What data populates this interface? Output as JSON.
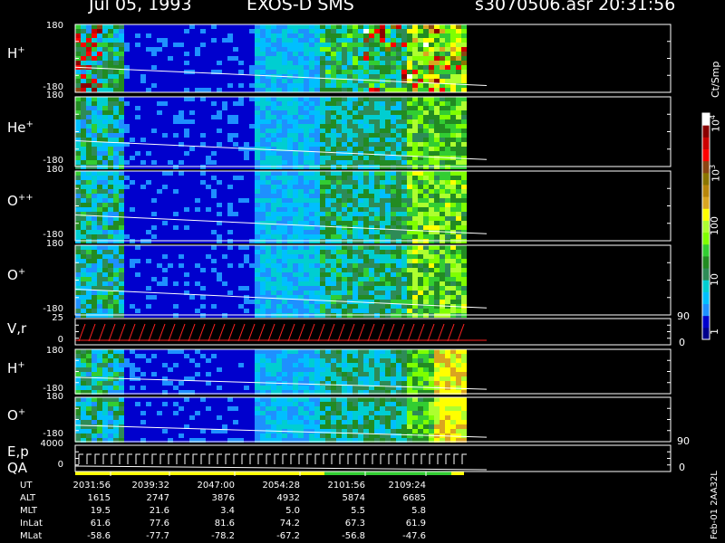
{
  "header": {
    "date": "Jul 05, 1993",
    "instrument": "EXOS-D SMS",
    "file": "s3070506.asr",
    "time": "20:31:56"
  },
  "panels": [
    {
      "id": "h_plus",
      "label_main": "H",
      "label_sup": "+",
      "ymax": "180",
      "ymin": "-180"
    },
    {
      "id": "he_plus",
      "label_main": "He",
      "label_sup": "+",
      "ymax": "180",
      "ymin": "-180"
    },
    {
      "id": "o_pp",
      "label_main": "O",
      "label_sup": "++",
      "ymax": "180",
      "ymin": "-180"
    },
    {
      "id": "o_plus",
      "label_main": "O",
      "label_sup": "+",
      "ymax": "180",
      "ymin": "-180"
    },
    {
      "id": "vr",
      "label_main": "V,r",
      "label_sup": "",
      "ymax": "25",
      "ymin": "0",
      "rmax": "90",
      "rmin": "0"
    },
    {
      "id": "h_plus2",
      "label_main": "H",
      "label_sup": "+",
      "ymax": "180",
      "ymin": "-180"
    },
    {
      "id": "o_plus2",
      "label_main": "O",
      "label_sup": "+",
      "ymax": "180",
      "ymin": "-180"
    },
    {
      "id": "ep",
      "label_main": "E,p",
      "label_sup": "",
      "ymax": "4000",
      "ymin": "0",
      "rmax": "90",
      "rmin": "0"
    }
  ],
  "qa_label": "QA",
  "colorbar": {
    "units": "Ct/Smp",
    "ticks": [
      "1",
      "10",
      "100",
      "10",
      "10"
    ],
    "tick_sups": [
      "",
      "",
      "",
      "3",
      "4"
    ],
    "colors": [
      "#00008b",
      "#0000cd",
      "#1e90ff",
      "#00bfff",
      "#00ced1",
      "#2e8b57",
      "#228b22",
      "#32cd32",
      "#7fff00",
      "#adff2f",
      "#ffff00",
      "#daa520",
      "#b8860b",
      "#8b7500",
      "#8b4513",
      "#ff0000",
      "#cc0000",
      "#8b0000",
      "#ffffff"
    ]
  },
  "ephemeris": {
    "rows": [
      {
        "name": "UT",
        "values": [
          "2031:56",
          "2039:32",
          "2047:00",
          "2054:28",
          "2101:56",
          "2109:24"
        ]
      },
      {
        "name": "ALT",
        "values": [
          "1615",
          "2747",
          "3876",
          "4932",
          "5874",
          "6685"
        ]
      },
      {
        "name": "MLT",
        "values": [
          "19.5",
          "21.6",
          "3.4",
          "5.0",
          "5.5",
          "5.8"
        ]
      },
      {
        "name": "InLat",
        "values": [
          "61.6",
          "77.6",
          "81.6",
          "74.2",
          "67.3",
          "61.9"
        ]
      },
      {
        "name": "MLat",
        "values": [
          "-58.6",
          "-77.7",
          "-78.2",
          "-67.2",
          "-56.8",
          "-47.6"
        ]
      }
    ]
  },
  "footer": "Feb-01 2AA32L",
  "chart_data": {
    "type": "heatmap",
    "title": "Jul 05, 1993  EXOS-D SMS",
    "x": [
      "2031:56",
      "2039:32",
      "2047:00",
      "2054:28",
      "2101:56",
      "2109:24"
    ],
    "xlabel": "UT",
    "ylabel": "",
    "series": [
      {
        "name": "H+",
        "ylim": [
          -180,
          180
        ]
      },
      {
        "name": "He+",
        "ylim": [
          -180,
          180
        ]
      },
      {
        "name": "O++",
        "ylim": [
          -180,
          180
        ]
      },
      {
        "name": "O+",
        "ylim": [
          -180,
          180
        ]
      },
      {
        "name": "V,r",
        "ylim": [
          0,
          25
        ]
      },
      {
        "name": "H+",
        "ylim": [
          -180,
          180
        ]
      },
      {
        "name": "O+",
        "ylim": [
          -180,
          180
        ]
      },
      {
        "name": "E,p",
        "ylim": [
          0,
          4000
        ]
      }
    ],
    "color_scale": "log",
    "color_range": [
      1,
      10000
    ],
    "color_units": "Ct/Smp"
  }
}
